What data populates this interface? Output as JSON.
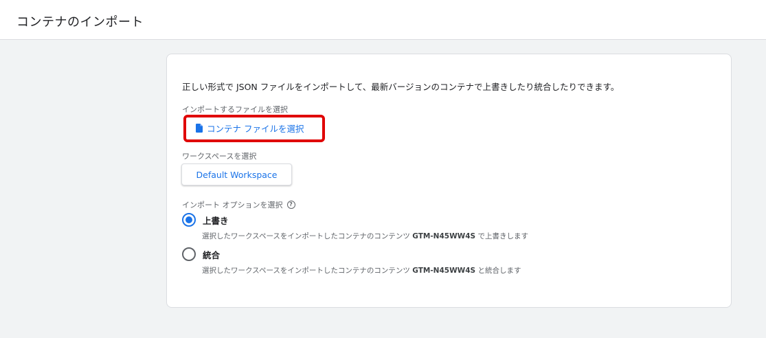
{
  "header": {
    "title": "コンテナのインポート"
  },
  "main": {
    "description": "正しい形式で JSON ファイルをインポートして、最新バージョンのコンテナで上書きしたり統合したりできます。",
    "file_section": {
      "label": "インポートするファイルを選択",
      "button_label": "コンテナ ファイルを選択",
      "icon": "file-icon",
      "highlight_color": "#e00000"
    },
    "workspace_section": {
      "label": "ワークスペースを選択",
      "button_label": "Default Workspace"
    },
    "options_section": {
      "label": "インポート オプションを選択",
      "help_icon_glyph": "?",
      "options": [
        {
          "label": "上書き",
          "selected": true,
          "desc_prefix": "選択したワークスペースをインポートしたコンテナのコンテンツ",
          "container_id": "GTM-N45WW4S",
          "desc_suffix": "で上書きします"
        },
        {
          "label": "統合",
          "selected": false,
          "desc_prefix": "選択したワークスペースをインポートしたコンテナのコンテンツ",
          "container_id": "GTM-N45WW4S",
          "desc_suffix": "と統合します"
        }
      ]
    }
  },
  "colors": {
    "accent": "#1a73e8",
    "background": "#f1f3f4",
    "highlight": "#e00000"
  }
}
